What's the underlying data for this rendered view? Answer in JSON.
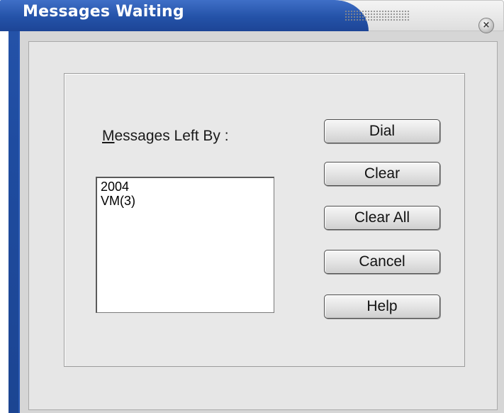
{
  "window": {
    "title": "Messages Waiting",
    "close_glyph": "×",
    "accent_color": "#2452a8"
  },
  "icons": {
    "grip": "dotted-grip-icon",
    "close": "close-icon"
  },
  "list": {
    "label_accesskey": "M",
    "label_rest": "essages Left By :",
    "items": [
      "2004",
      "VM(3)"
    ]
  },
  "buttons": {
    "dial": "Dial",
    "clear": "Clear",
    "clear_all": "Clear All",
    "cancel": "Cancel",
    "help": "Help"
  }
}
